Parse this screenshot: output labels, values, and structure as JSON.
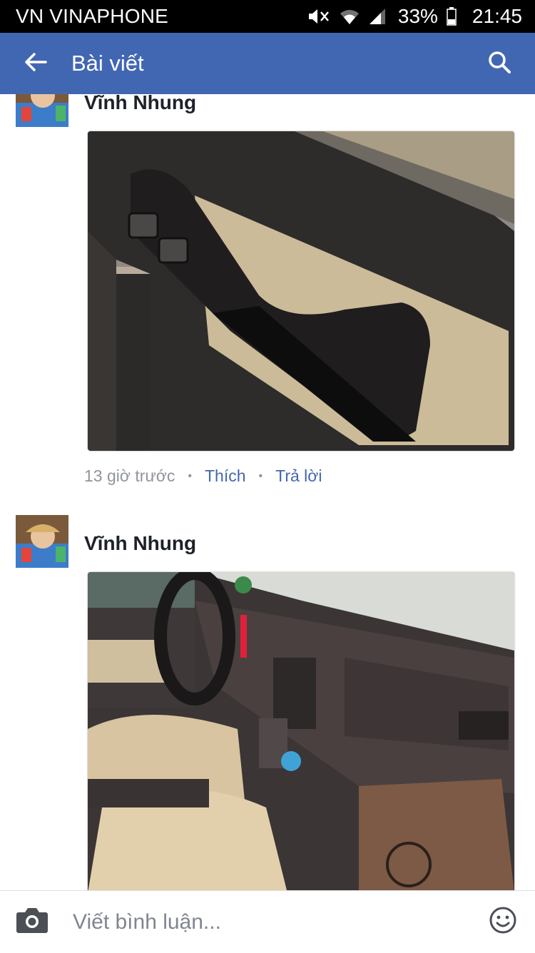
{
  "status_bar": {
    "carrier": "VN VINAPHONE",
    "battery": "33%",
    "time": "21:45",
    "icons": [
      "mute-icon",
      "wifi-icon",
      "signal-icon",
      "battery-icon"
    ]
  },
  "app_bar": {
    "title": "Bài viết",
    "back_icon": "arrow-left-icon",
    "search_icon": "search-icon",
    "color": "#4267b2"
  },
  "comments": [
    {
      "author": "Vĩnh Nhung",
      "photo": "car-door-interior-photo",
      "time": "13 giờ trước",
      "like_label": "Thích",
      "reply_label": "Trả lời"
    },
    {
      "author": "Vĩnh Nhung",
      "photo": "car-dashboard-interior-photo"
    }
  ],
  "composer": {
    "placeholder": "Viết bình luận...",
    "camera_icon": "camera-icon",
    "emoji_icon": "smiley-icon"
  }
}
